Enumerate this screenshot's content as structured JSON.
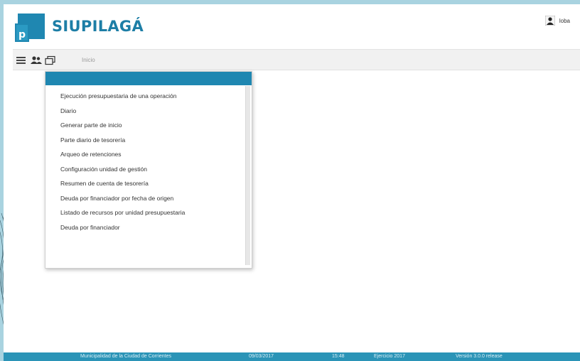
{
  "header": {
    "logo_part1": "SIU",
    "logo_part2": "PILAGÁ",
    "user_name": "loba"
  },
  "toolbar": {
    "breadcrumb": "Inicio"
  },
  "dropdown": {
    "items": [
      "Ejecución presupuestaria de una operación",
      "Diario",
      "Generar parte de inicio",
      "Parte diario de tesorería",
      "Arqueo de retenciones",
      "Configuración unidad de gestión",
      "Resumen de cuenta de tesorería",
      "Deuda por financiador por fecha de origen",
      "Listado de recursos por unidad presupuestaria",
      "Deuda por financiador"
    ]
  },
  "footer": {
    "organization": "Municipalidad de la Ciudad de Corrientes",
    "date": "09/03/2017",
    "time": "15:48",
    "fiscal_year": "Ejercicio 2017",
    "version": "Versión 3.0.0 release"
  },
  "colors": {
    "accent": "#1f87b1",
    "logo": "#1d7ea6",
    "footer": "#2b94b7",
    "frame": "#a9d3e0"
  },
  "icons": [
    "logo-mark-icon",
    "user-icon",
    "hamburger-menu-icon",
    "users-icon",
    "window-icon"
  ]
}
